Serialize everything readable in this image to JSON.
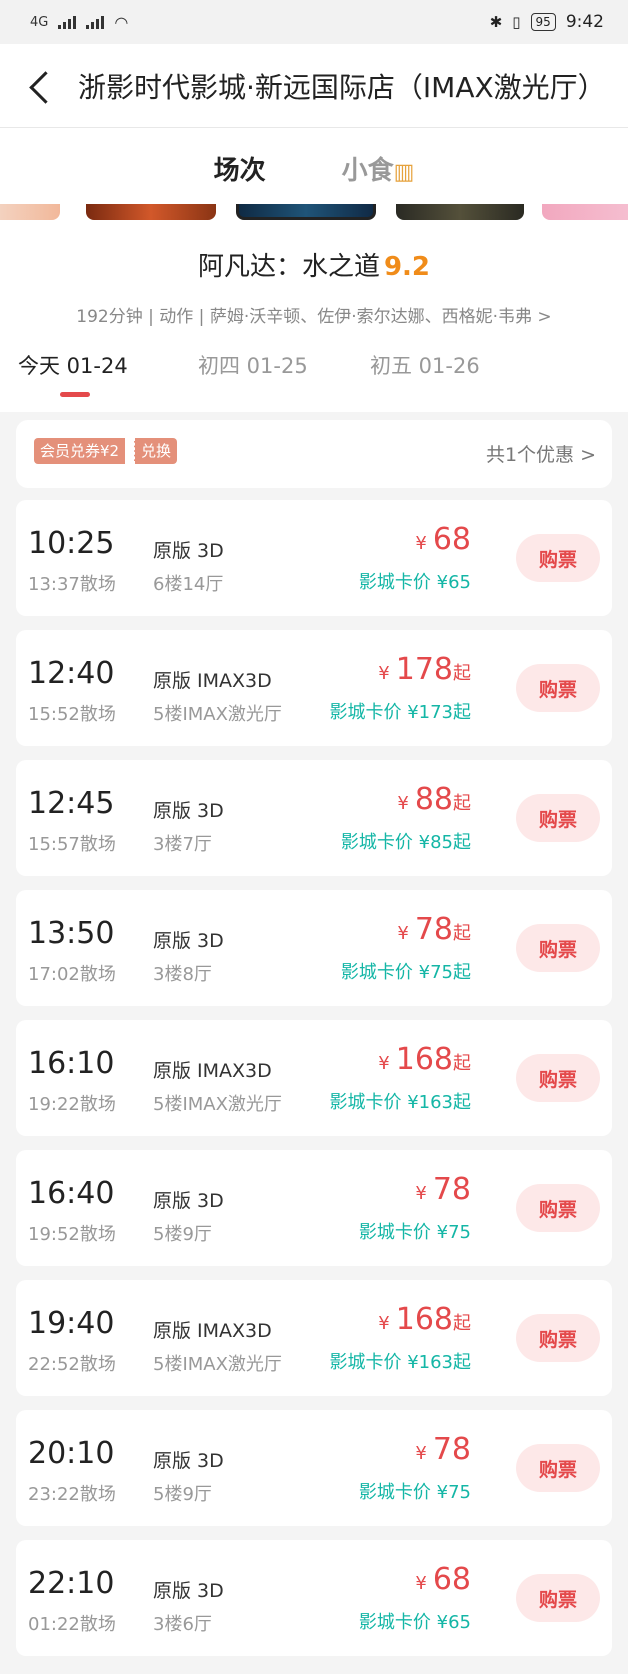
{
  "status_bar": {
    "time": "9:42",
    "battery": "95",
    "network": "4G"
  },
  "header": {
    "title": "浙影时代影城·新远国际店（IMAX激光厅）"
  },
  "tabs": [
    {
      "label": "场次"
    },
    {
      "label": "小食"
    }
  ],
  "movie": {
    "title": "阿凡达：水之道",
    "score": "9.2",
    "meta": "192分钟 | 动作 | 萨姆·沃辛顿、佐伊·索尔达娜、西格妮·韦弗 >"
  },
  "dates": [
    {
      "label": "今天 01-24"
    },
    {
      "label": "初四 01-25"
    },
    {
      "label": "初五 01-26"
    }
  ],
  "coupon": {
    "tag": "会员兑券¥2",
    "action": "兑换",
    "offer": "共1个优惠 >"
  },
  "price_symbol": "¥",
  "from_suffix": "起",
  "buy_label": "购票",
  "showtimes": [
    {
      "time": "10:25",
      "end": "13:37散场",
      "version": "原版 3D",
      "hall": "6楼14厅",
      "price": "68",
      "from": false,
      "card_price": "影城卡价 ¥65"
    },
    {
      "time": "12:40",
      "end": "15:52散场",
      "version": "原版 IMAX3D",
      "hall": "5楼IMAX激光厅",
      "price": "178",
      "from": true,
      "card_price": "影城卡价 ¥173起"
    },
    {
      "time": "12:45",
      "end": "15:57散场",
      "version": "原版 3D",
      "hall": "3楼7厅",
      "price": "88",
      "from": true,
      "card_price": "影城卡价 ¥85起"
    },
    {
      "time": "13:50",
      "end": "17:02散场",
      "version": "原版 3D",
      "hall": "3楼8厅",
      "price": "78",
      "from": true,
      "card_price": "影城卡价 ¥75起"
    },
    {
      "time": "16:10",
      "end": "19:22散场",
      "version": "原版 IMAX3D",
      "hall": "5楼IMAX激光厅",
      "price": "168",
      "from": true,
      "card_price": "影城卡价 ¥163起"
    },
    {
      "time": "16:40",
      "end": "19:52散场",
      "version": "原版 3D",
      "hall": "5楼9厅",
      "price": "78",
      "from": false,
      "card_price": "影城卡价 ¥75"
    },
    {
      "time": "19:40",
      "end": "22:52散场",
      "version": "原版 IMAX3D",
      "hall": "5楼IMAX激光厅",
      "price": "168",
      "from": true,
      "card_price": "影城卡价 ¥163起"
    },
    {
      "time": "20:10",
      "end": "23:22散场",
      "version": "原版 3D",
      "hall": "5楼9厅",
      "price": "78",
      "from": false,
      "card_price": "影城卡价 ¥75"
    },
    {
      "time": "22:10",
      "end": "01:22散场",
      "version": "原版 3D",
      "hall": "3楼6厅",
      "price": "68",
      "from": false,
      "card_price": "影城卡价 ¥65"
    }
  ],
  "colors": {
    "accent": "#e4494b",
    "score": "#f08c1a",
    "card_price": "#14b6a6",
    "buy_bg": "#fde8e8"
  }
}
